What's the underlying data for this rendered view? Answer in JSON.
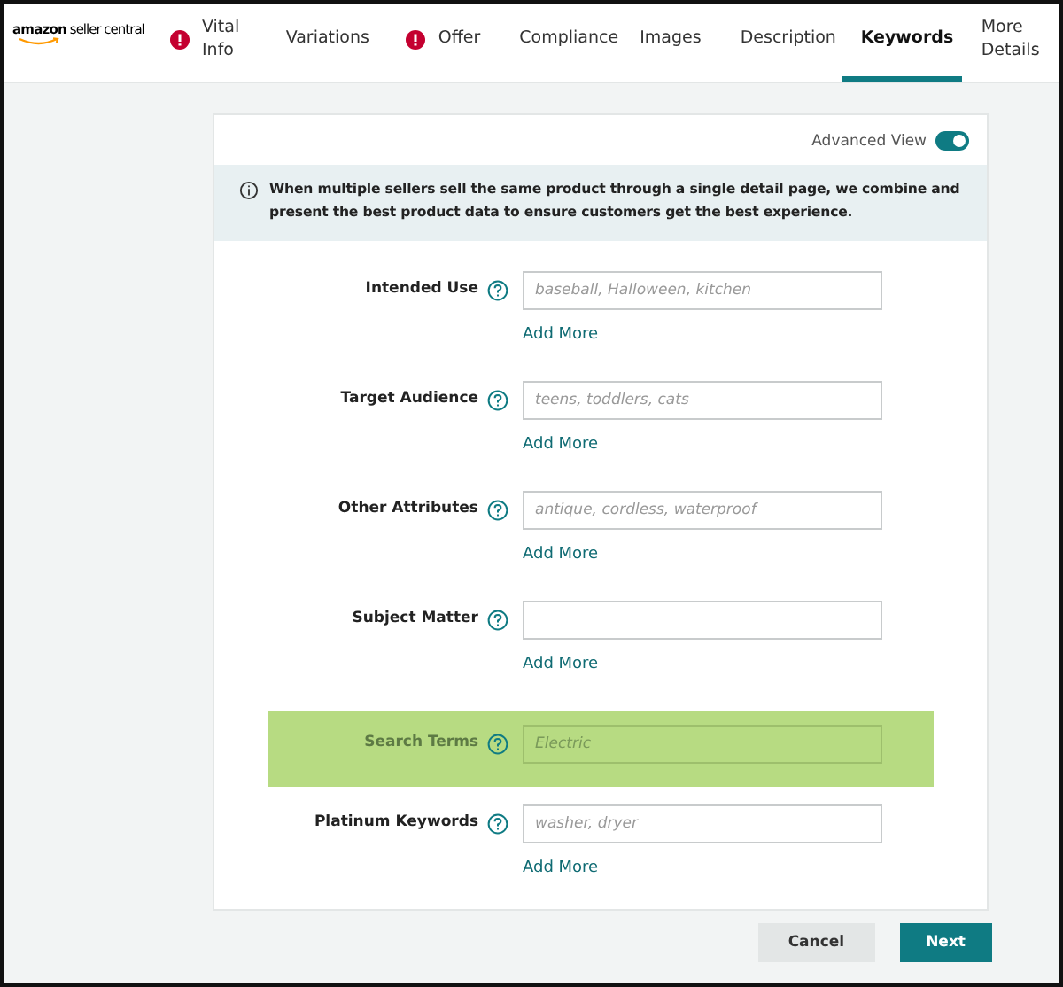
{
  "logo": {
    "brand": "amazon",
    "product": "seller central"
  },
  "tabs": [
    {
      "label": "Vital Info",
      "alert": true,
      "selected": false
    },
    {
      "label": "Variations",
      "alert": false,
      "selected": false
    },
    {
      "label": "Offer",
      "alert": true,
      "selected": false
    },
    {
      "label": "Compliance",
      "alert": false,
      "selected": false
    },
    {
      "label": "Images",
      "alert": false,
      "selected": false
    },
    {
      "label": "Description",
      "alert": false,
      "selected": false
    },
    {
      "label": "Keywords",
      "alert": false,
      "selected": true
    },
    {
      "label": "More Details",
      "alert": false,
      "selected": false
    }
  ],
  "advanced_view": {
    "label": "Advanced View",
    "on": true
  },
  "notice": "When multiple sellers sell the same product through a single detail page, we combine and present the best product data to ensure customers get the best experience.",
  "fields": [
    {
      "label": "Intended Use",
      "placeholder": "baseball, Halloween, kitchen",
      "add_more": "Add More",
      "highlighted": false
    },
    {
      "label": "Target Audience",
      "placeholder": "teens, toddlers, cats",
      "add_more": "Add More",
      "highlighted": false
    },
    {
      "label": "Other Attributes",
      "placeholder": "antique, cordless, waterproof",
      "add_more": "Add More",
      "highlighted": false
    },
    {
      "label": "Subject Matter",
      "add_more": "Add More",
      "highlighted": false
    },
    {
      "label": "Search Terms",
      "placeholder": "Electric",
      "highlighted": true
    },
    {
      "label": "Platinum Keywords",
      "placeholder": "washer, dryer",
      "add_more": "Add More",
      "highlighted": false
    }
  ],
  "buttons": {
    "cancel": "Cancel",
    "next": "Next"
  }
}
